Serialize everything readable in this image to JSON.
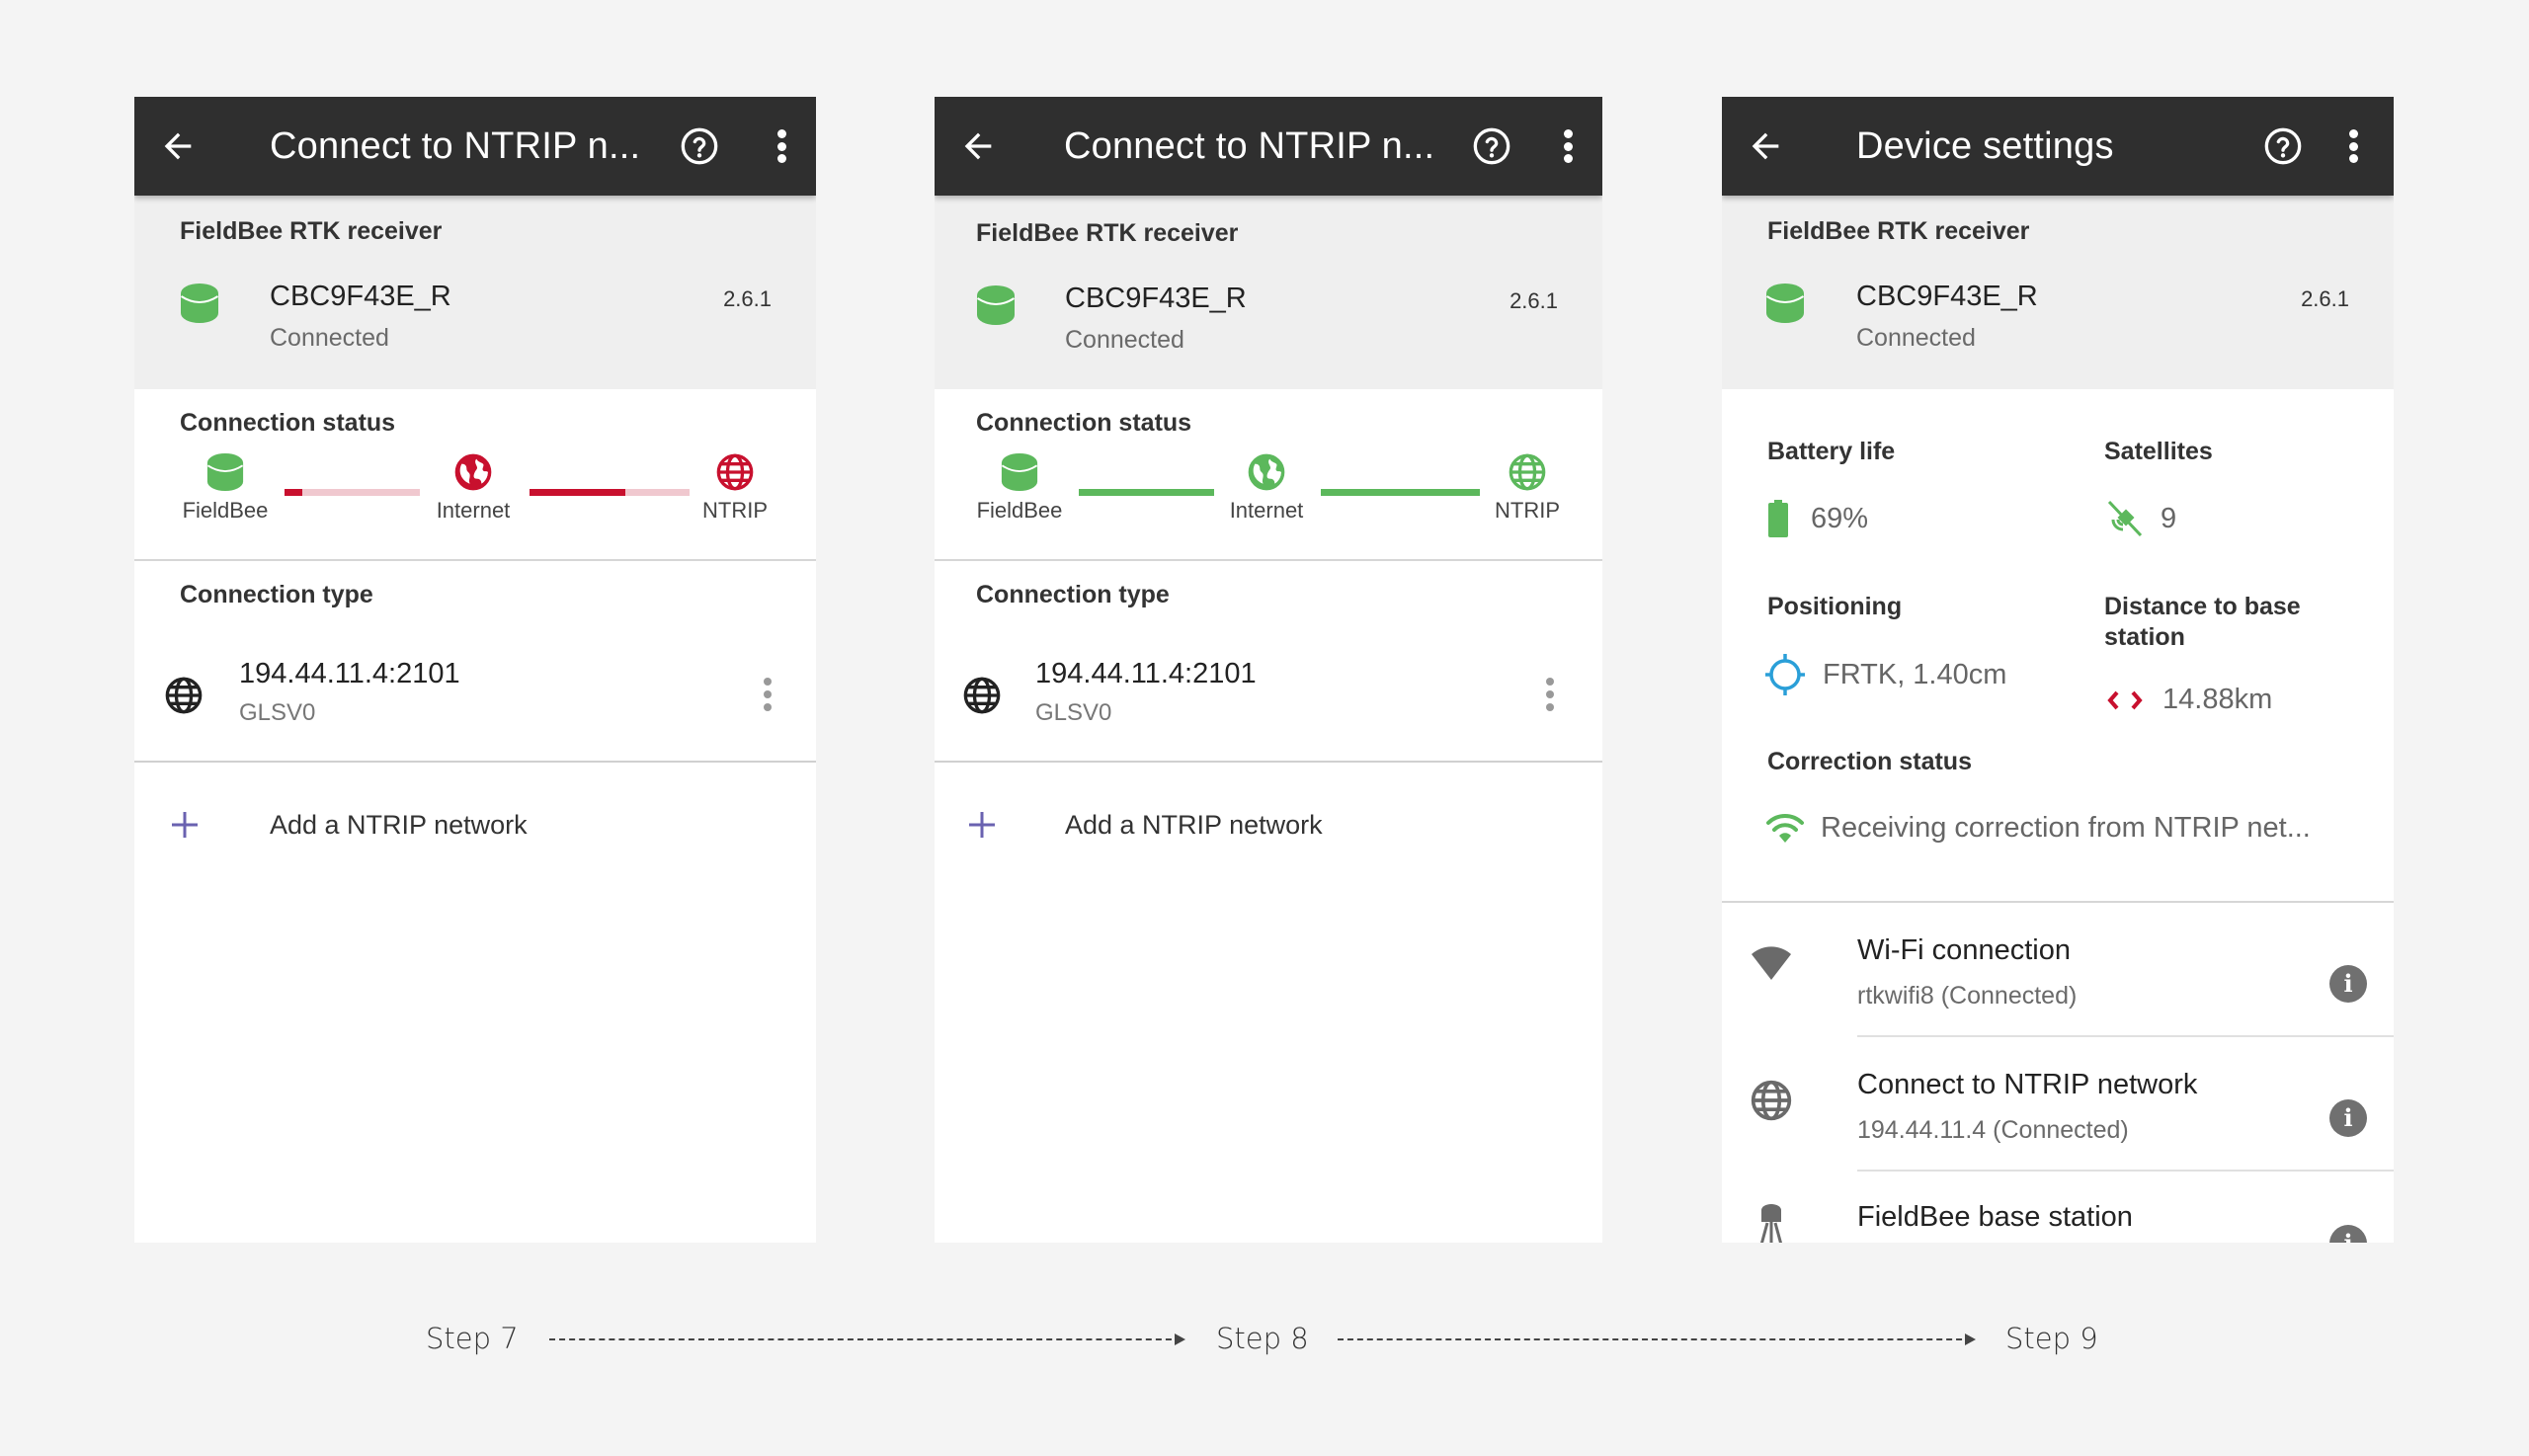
{
  "panels": [
    {
      "appbar": {
        "title": "Connect to NTRIP n..."
      },
      "receiver": {
        "section_label": "FieldBee RTK receiver",
        "device_name": "CBC9F43E_R",
        "device_status": "Connected",
        "version": "2.6.1"
      },
      "connection_status": {
        "label": "Connection status",
        "nodes": [
          "FieldBee",
          "Internet",
          "NTRIP"
        ],
        "node_colors": [
          "#5cb85c",
          "#c8102e",
          "#c8102e"
        ],
        "links": [
          {
            "progress": 0.13,
            "fill_color": "#c8102e",
            "track_color": "#f0c8cf"
          },
          {
            "progress": 0.6,
            "fill_color": "#c8102e",
            "track_color": "#f0c8cf"
          }
        ]
      },
      "connection_type": {
        "label": "Connection type",
        "address": "194.44.11.4:2101",
        "mountpoint": "GLSV0"
      },
      "add_network": {
        "label": "Add a NTRIP network"
      }
    },
    {
      "appbar": {
        "title": "Connect to NTRIP n..."
      },
      "receiver": {
        "section_label": "FieldBee RTK receiver",
        "device_name": "CBC9F43E_R",
        "device_status": "Connected",
        "version": "2.6.1"
      },
      "connection_status": {
        "label": "Connection status",
        "nodes": [
          "FieldBee",
          "Internet",
          "NTRIP"
        ],
        "node_colors": [
          "#5cb85c",
          "#5cb85c",
          "#5cb85c"
        ],
        "links": [
          {
            "progress": 1.0,
            "fill_color": "#5cb85c",
            "track_color": "#cdeacd"
          },
          {
            "progress": 1.0,
            "fill_color": "#5cb85c",
            "track_color": "#cdeacd"
          }
        ]
      },
      "connection_type": {
        "label": "Connection type",
        "address": "194.44.11.4:2101",
        "mountpoint": "GLSV0"
      },
      "add_network": {
        "label": "Add a NTRIP network"
      }
    },
    {
      "appbar": {
        "title": "Device settings"
      },
      "receiver": {
        "section_label": "FieldBee RTK receiver",
        "device_name": "CBC9F43E_R",
        "device_status": "Connected",
        "version": "2.6.1"
      },
      "stats": {
        "battery": {
          "label": "Battery life",
          "value": "69%",
          "percent": 69
        },
        "satellites": {
          "label": "Satellites",
          "value": "9"
        },
        "positioning": {
          "label": "Positioning",
          "value": "FRTK, 1.40cm"
        },
        "distance": {
          "label": "Distance to base station",
          "value": "14.88km"
        },
        "correction": {
          "label": "Correction status",
          "value": "Receiving correction from NTRIP net..."
        }
      },
      "list": [
        {
          "title": "Wi-Fi connection",
          "subtitle": "rtkwifi8  (Connected)",
          "icon": "wifi-icon"
        },
        {
          "title": "Connect to NTRIP network",
          "subtitle": "194.44.11.4  (Connected)",
          "icon": "globe-icon"
        },
        {
          "title": "FieldBee base station",
          "subtitle": "",
          "icon": "base-station-icon"
        }
      ]
    }
  ],
  "steps": [
    "Step 7",
    "Step 8",
    "Step 9"
  ],
  "colors": {
    "appbar": "#2f2f2f",
    "green": "#5cb85c",
    "red": "#c8102e",
    "blue": "#2a9fd8",
    "purple": "#6a62b0"
  }
}
